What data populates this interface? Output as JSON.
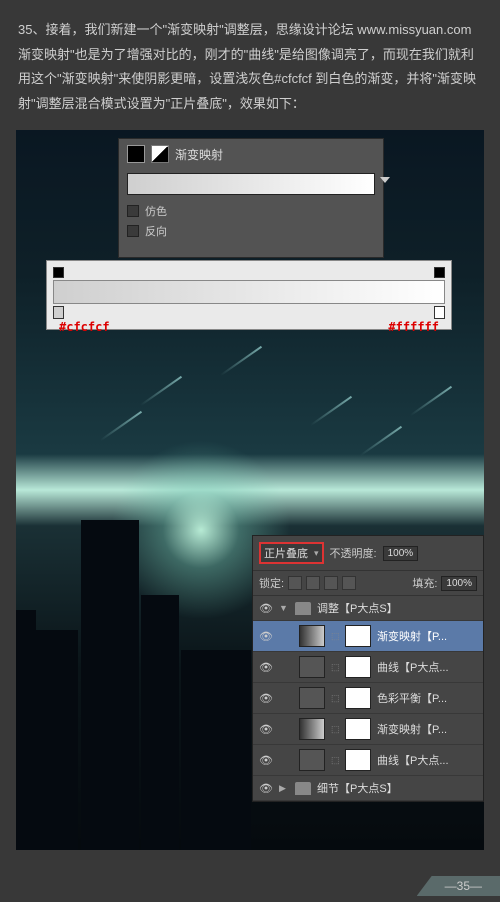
{
  "instruction_text": "35、接着，我们新建一个\"渐变映射\"调整层，思缘设计论坛 www.missyuan.com 渐变映射\"也是为了增强对比的，刚才的\"曲线\"是给图像调亮了，而现在我们就利用这个\"渐变映射\"来使阴影更暗，设置浅灰色#cfcfcf 到白色的渐变，并将\"渐变映射\"调整层混合模式设置为\"正片叠底\"，效果如下：",
  "gradient_panel": {
    "title": "渐变映射",
    "dither_label": "仿色",
    "reverse_label": "反向"
  },
  "gradient_editor": {
    "left_hex": "#cfcfcf",
    "right_hex": "#ffffff"
  },
  "layers_panel": {
    "blend_mode": "正片叠底",
    "opacity_label": "不透明度:",
    "opacity_value": "100%",
    "lock_label": "锁定:",
    "fill_label": "填充:",
    "fill_value": "100%",
    "group1": "调整【P大点S】",
    "group2": "细节【P大点S】",
    "layers": [
      {
        "name": "渐变映射【P...",
        "type": "gradient",
        "selected": true
      },
      {
        "name": "曲线【P大点...",
        "type": "curves"
      },
      {
        "name": "色彩平衡【P...",
        "type": "balance"
      },
      {
        "name": "渐变映射【P...",
        "type": "gradient"
      },
      {
        "name": "曲线【P大点...",
        "type": "curves"
      }
    ]
  },
  "page_number": "—35—"
}
